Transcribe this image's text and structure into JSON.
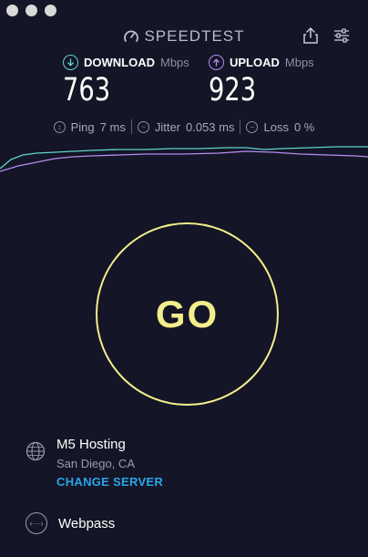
{
  "app": {
    "title": "SPEEDTEST"
  },
  "download": {
    "label": "DOWNLOAD",
    "unit": "Mbps",
    "value": "763",
    "color": "#5fd4c9"
  },
  "upload": {
    "label": "UPLOAD",
    "unit": "Mbps",
    "value": "923",
    "color": "#b48cf0"
  },
  "stats": {
    "ping_label": "Ping",
    "ping_value": "7 ms",
    "jitter_label": "Jitter",
    "jitter_value": "0.053 ms",
    "loss_label": "Loss",
    "loss_value": "0 %"
  },
  "go_button": {
    "label": "GO",
    "color": "#f3ee8c"
  },
  "server": {
    "name": "M5 Hosting",
    "location": "San Diego, CA",
    "change_label": "CHANGE SERVER"
  },
  "provider": {
    "name": "Webpass"
  },
  "icons": {
    "gauge": "speedometer-icon",
    "share": "share-icon",
    "settings": "sliders-icon",
    "download": "arrow-down-circle-icon",
    "upload": "arrow-up-circle-icon",
    "server": "globe-icon",
    "provider": "network-icon"
  }
}
